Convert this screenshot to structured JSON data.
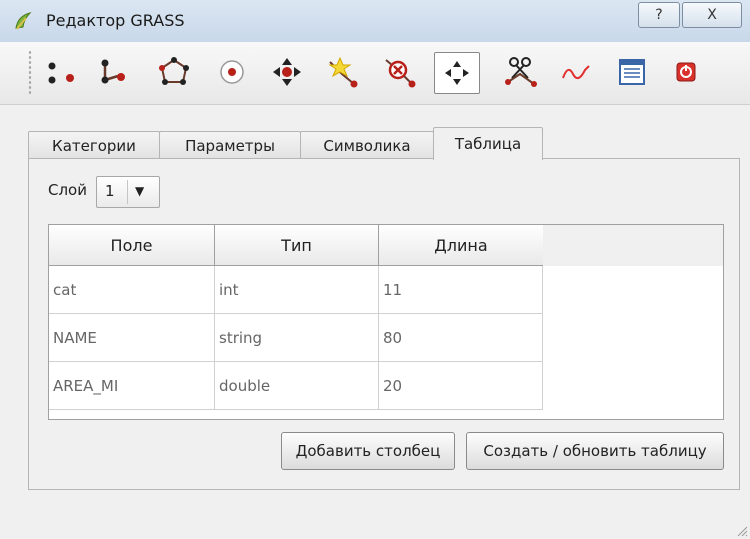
{
  "window": {
    "title": "Редактор GRASS",
    "help_label": "?",
    "close_label": "X"
  },
  "toolbar": {
    "tools": [
      {
        "icon": "new-point-icon"
      },
      {
        "icon": "new-line-icon"
      },
      {
        "icon": "new-boundary-icon"
      },
      {
        "icon": "new-centroid-icon"
      },
      {
        "icon": "move-vertex-icon"
      },
      {
        "icon": "add-vertex-icon"
      },
      {
        "icon": "delete-vertex-icon"
      },
      {
        "icon": "move-element-icon",
        "active": true
      },
      {
        "icon": "split-line-icon"
      },
      {
        "icon": "delete-element-icon"
      },
      {
        "icon": "edit-attributes-icon"
      },
      {
        "icon": "close-editor-icon"
      }
    ]
  },
  "tabs": [
    {
      "label": "Категории"
    },
    {
      "label": "Параметры"
    },
    {
      "label": "Символика"
    },
    {
      "label": "Таблица",
      "active": true
    }
  ],
  "layer": {
    "label": "Слой",
    "value": "1"
  },
  "table": {
    "headers": [
      "Поле",
      "Тип",
      "Длина"
    ],
    "rows": [
      [
        "cat",
        "int",
        "11"
      ],
      [
        "NAME",
        "string",
        "80"
      ],
      [
        "AREA_MI",
        "double",
        "20"
      ]
    ]
  },
  "buttons": {
    "add_column": "Добавить столбец",
    "create_update": "Создать / обновить таблицу"
  }
}
